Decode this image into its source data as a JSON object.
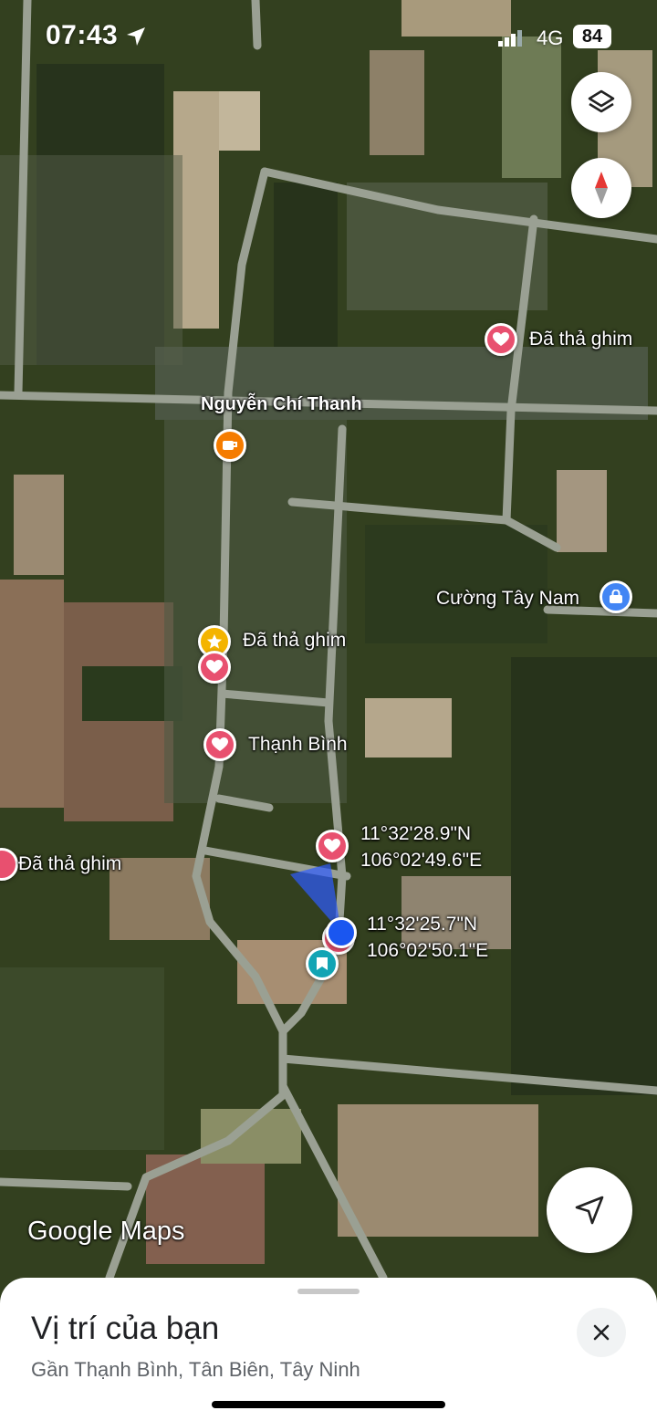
{
  "status_bar": {
    "time": "07:43",
    "network": "4G",
    "battery": "84"
  },
  "map": {
    "street_label": "Nguyễn Chí Thanh",
    "places": [
      {
        "label": "Đã thả ghim",
        "kind": "saved-pin"
      },
      {
        "label": "Đã thả ghim",
        "kind": "starred-pin"
      },
      {
        "label": "Thạnh Bình",
        "kind": "saved-pin"
      },
      {
        "label": "Đã thả ghim",
        "kind": "saved-pin"
      },
      {
        "label": "Cường Tây Nam",
        "kind": "shopping-pin"
      }
    ],
    "coordinates": [
      {
        "lat": "11°32'28.9\"N",
        "lon": "106°02'49.6\"E"
      },
      {
        "lat": "11°32'25.7\"N",
        "lon": "106°02'50.1\"E"
      }
    ],
    "attribution": "Google Maps"
  },
  "sheet": {
    "title": "Vị trí của bạn",
    "subtitle": "Gần Thạnh Bình, Tân Biên, Tây Ninh"
  },
  "colors": {
    "saved_pin": "#e8506f",
    "star_pin": "#f4b400",
    "cafe_pin": "#f57c00",
    "shop_pin": "#4285f4",
    "bookmark_pin": "#12a4b4",
    "location_dot": "#1a56f0"
  }
}
